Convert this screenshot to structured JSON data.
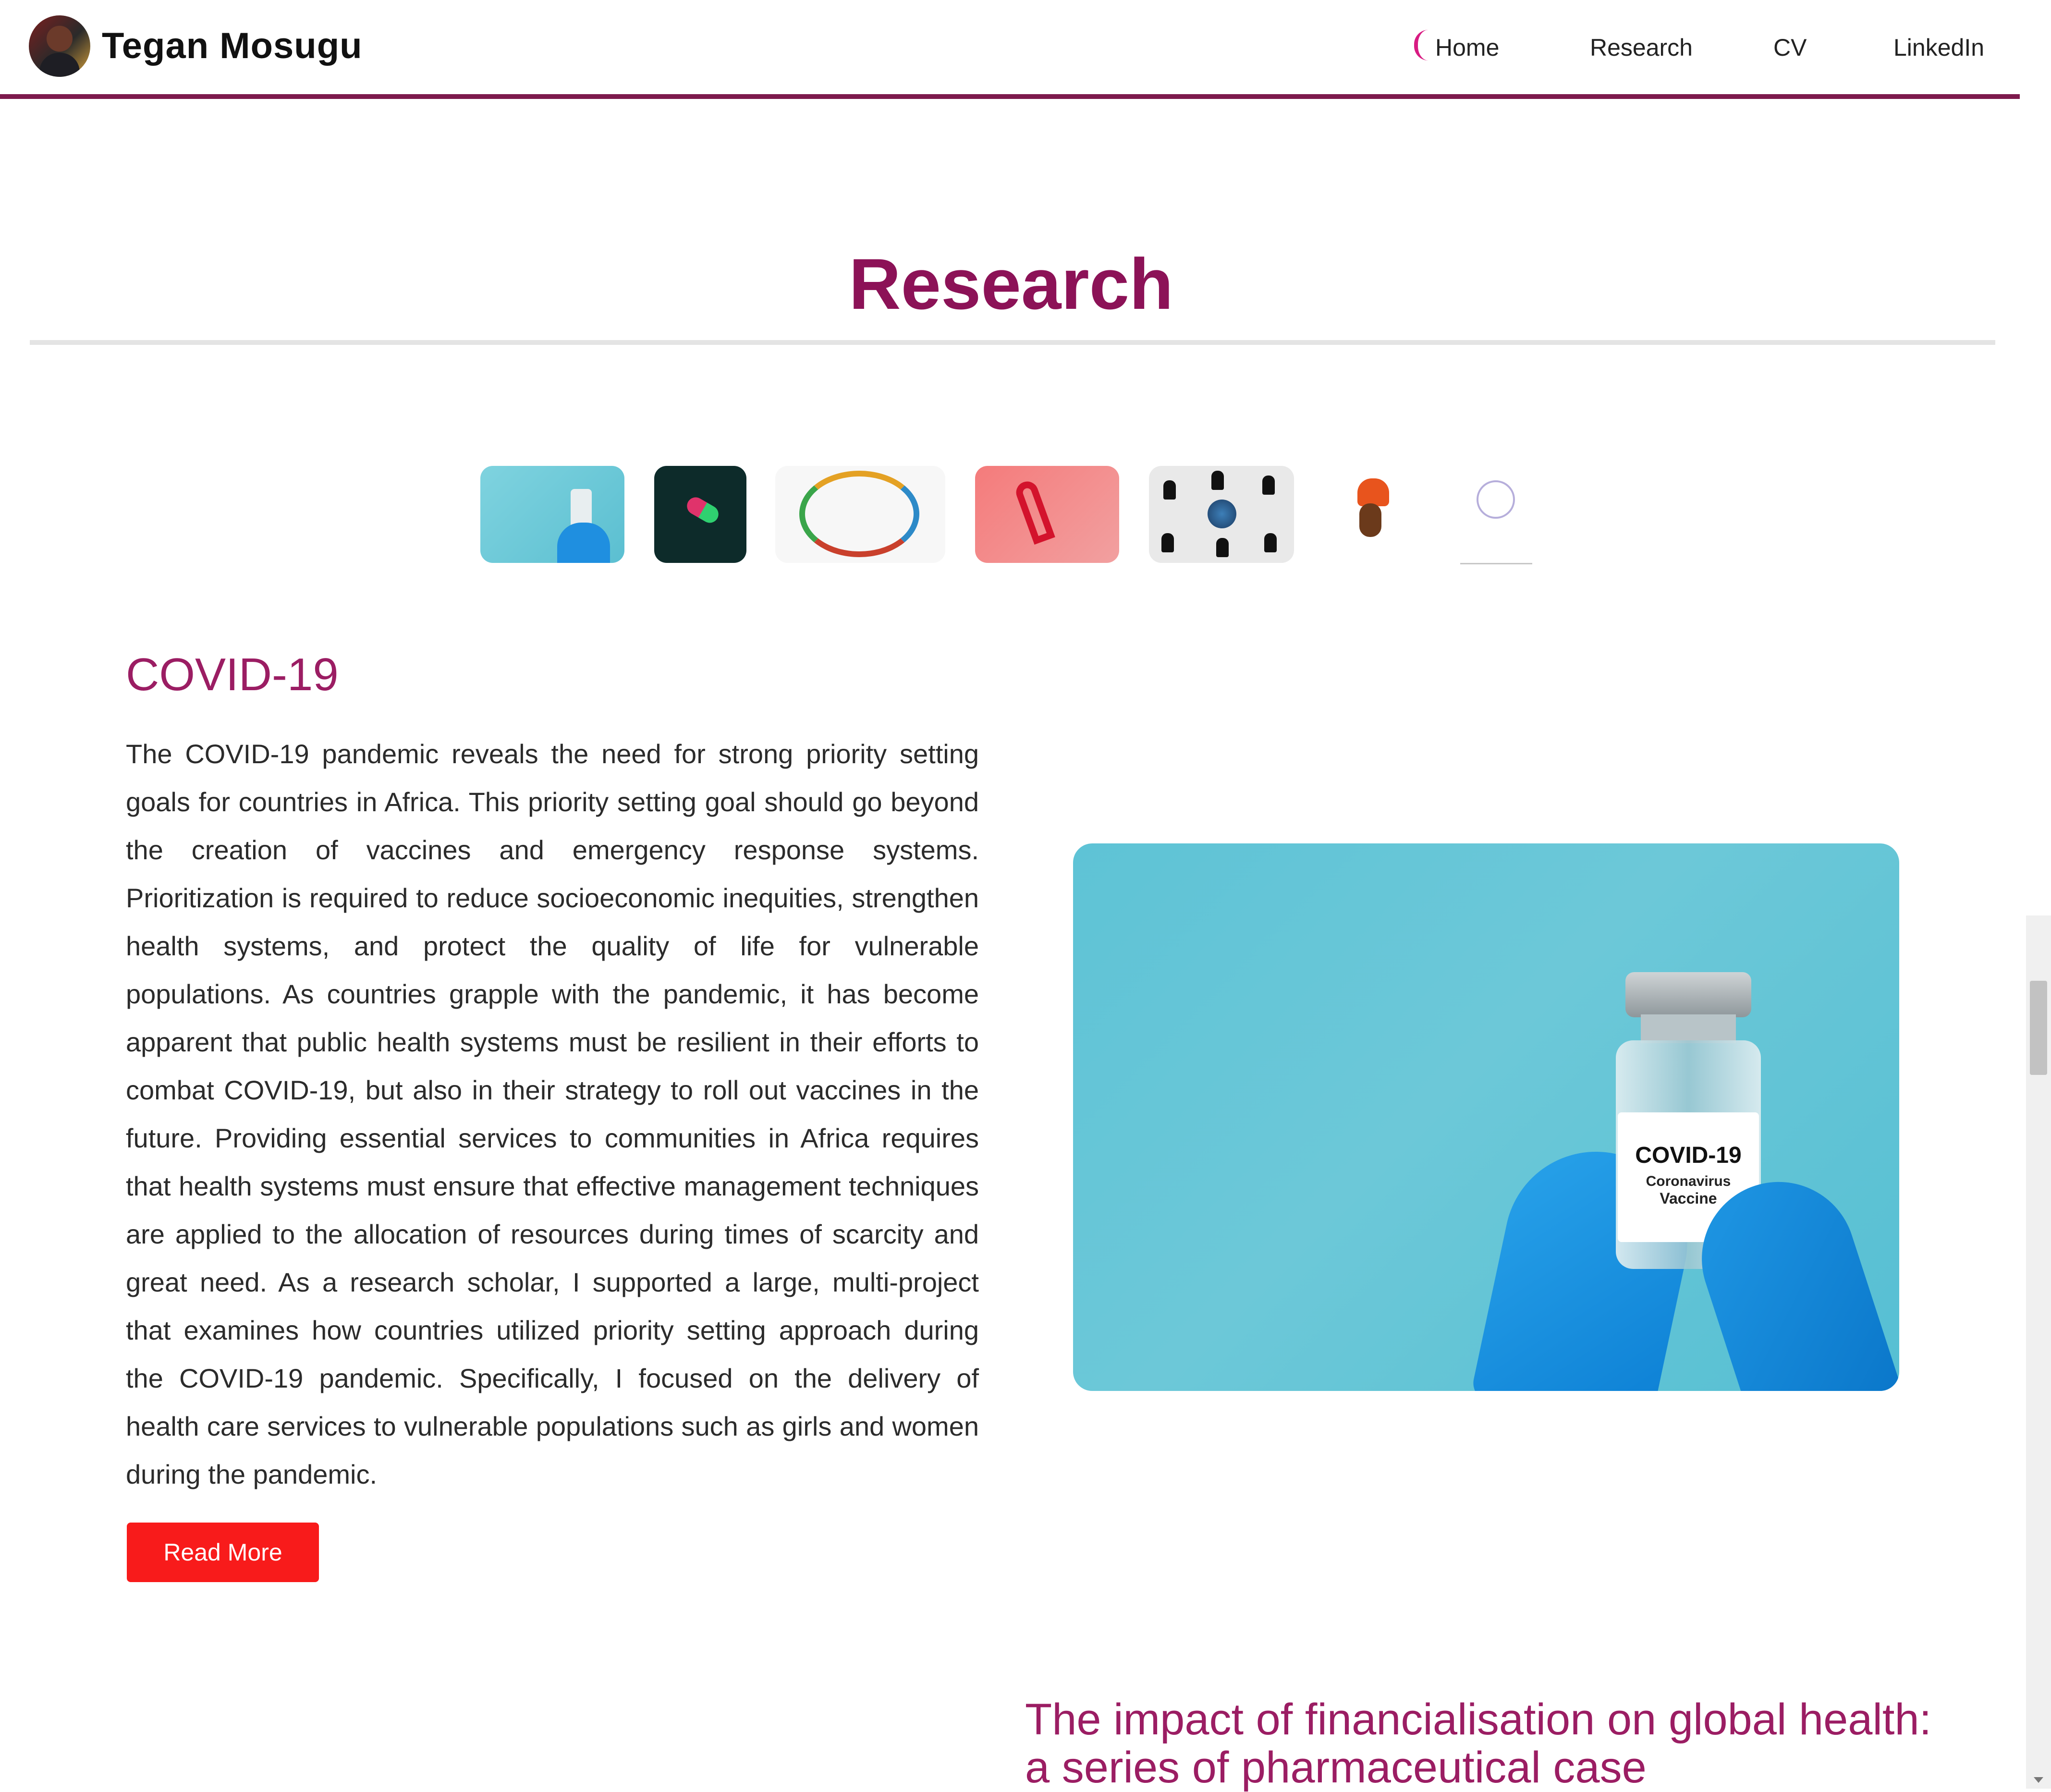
{
  "header": {
    "site_title": "Tegan Mosugu",
    "nav": [
      {
        "label": "Home"
      },
      {
        "label": "Research"
      },
      {
        "label": "CV"
      },
      {
        "label": "LinkedIn"
      }
    ],
    "accent_color": "#7d1a4d"
  },
  "page": {
    "title": "Research"
  },
  "thumbnails": [
    {
      "icon": "vaccine-vial-image"
    },
    {
      "icon": "pill-capsule-image"
    },
    {
      "icon": "organs-circle-image"
    },
    {
      "icon": "awareness-ribbon-image"
    },
    {
      "icon": "people-network-globe-image"
    },
    {
      "icon": "woman-headwrap-image"
    },
    {
      "icon": "project-logo-image"
    }
  ],
  "section": {
    "heading": "COVID-19",
    "body": "The COVID-19 pandemic reveals the need for strong priority setting goals for countries in Africa. This priority setting goal should go beyond the creation of vaccines and emergency response systems. Prioritization is required to reduce socioeconomic inequities, strengthen health systems, and protect the quality of life for vulnerable populations. As countries grapple with the pandemic, it has become apparent that public health systems must be resilient in their efforts to combat COVID-19, but also in their strategy to roll out vaccines in the future. Providing essential services to communities in Africa requires that health systems must ensure that effective management techniques are applied to the allocation of resources during times of scarcity and great need. As a research scholar, I supported a large, multi-project that examines how countries utilized priority setting approach during the COVID-19 pandemic. Specifically, I focused on the delivery of health care services to vulnerable populations such as girls and women during the pandemic.",
    "read_more_label": "Read More",
    "button_color": "#f81b1b",
    "image": {
      "label_line1": "COVID-19",
      "label_line2": "Coronavirus",
      "label_line3": "Vaccine"
    }
  },
  "next_section": {
    "heading": "The impact of financialisation on global health: a series of pharmaceutical case"
  }
}
